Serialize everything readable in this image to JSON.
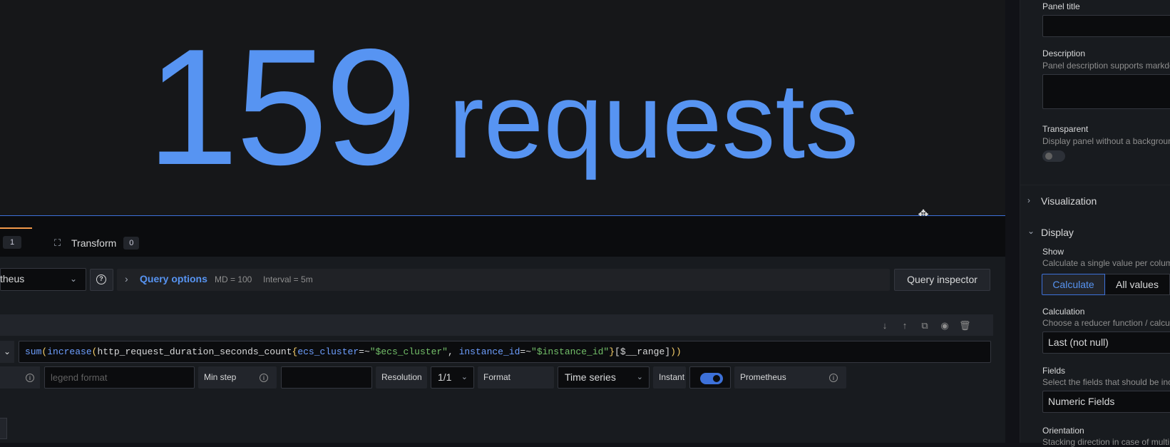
{
  "preview": {
    "value": "159",
    "unit": "requests"
  },
  "tabs": {
    "queries_count": "1",
    "transform_label": "Transform",
    "transform_count": "0"
  },
  "datasource": {
    "selected": "theus"
  },
  "query_options": {
    "label": "Query options",
    "md": "MD = 100",
    "interval": "Interval = 5m"
  },
  "query_inspector_label": "Query inspector",
  "query": {
    "tokens": [
      {
        "t": "sum",
        "c": "t-fn"
      },
      {
        "t": "(",
        "c": "t-paren"
      },
      {
        "t": "increase",
        "c": "t-fn"
      },
      {
        "t": "(",
        "c": "t-paren"
      },
      {
        "t": "http_request_duration_seconds_count",
        "c": "t-metric"
      },
      {
        "t": "{",
        "c": "t-paren"
      },
      {
        "t": "ecs_cluster",
        "c": "t-label"
      },
      {
        "t": "=~",
        "c": "t-op"
      },
      {
        "t": "\"$ecs_cluster\"",
        "c": "t-str"
      },
      {
        "t": ", ",
        "c": "t-op"
      },
      {
        "t": "instance_id",
        "c": "t-label"
      },
      {
        "t": "=~",
        "c": "t-op"
      },
      {
        "t": "\"$instance_id\"",
        "c": "t-str"
      },
      {
        "t": "}",
        "c": "t-paren"
      },
      {
        "t": "[",
        "c": "t-brk"
      },
      {
        "t": "$__range",
        "c": "t-dim"
      },
      {
        "t": "]",
        "c": "t-brk"
      },
      {
        "t": "))",
        "c": "t-paren"
      }
    ]
  },
  "query_row": {
    "legend_placeholder": "legend format",
    "min_step_label": "Min step",
    "resolution_label": "Resolution",
    "resolution_value": "1/1",
    "format_label": "Format",
    "format_value": "Time series",
    "instant_label": "Instant",
    "instant_on": true,
    "datasource_tag": "Prometheus"
  },
  "sidebar": {
    "panel_title_label": "Panel title",
    "description_label": "Description",
    "description_hint": "Panel description supports markdown and links.",
    "transparent_label": "Transparent",
    "transparent_hint": "Display panel without a background.",
    "visualization_label": "Visualization",
    "display_label": "Display",
    "show_label": "Show",
    "show_hint": "Calculate a single value per column or series or show each row",
    "show_options": [
      "Calculate",
      "All values"
    ],
    "calculation_label": "Calculation",
    "calculation_hint": "Choose a reducer function / calculation",
    "calculation_value": "Last (not null)",
    "fields_label": "Fields",
    "fields_hint": "Select the fields that should be included in the panel",
    "fields_value": "Numeric Fields",
    "orientation_label": "Orientation",
    "orientation_hint": "Stacking direction in case of multiple series or fields"
  }
}
